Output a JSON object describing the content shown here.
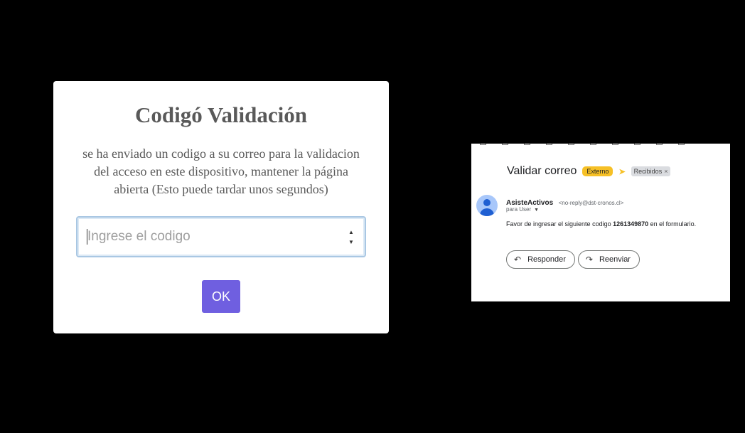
{
  "modal": {
    "title": "Codigó Validación",
    "message": "se ha enviado un codigo a su correo para la validacion del acceso en este dispositivo, mantener la página abierta (Esto puede tardar unos segundos)",
    "input_placeholder": "Ingrese el codigo",
    "ok_label": "OK",
    "ok_color": "#6f5fe0"
  },
  "email": {
    "subject": "Validar correo",
    "label_externo": "Externo",
    "label_recibidos": "Recibidos",
    "label_remove": "×",
    "sender_name": "AsisteActivos",
    "sender_email": "<no-reply@dst-cronos.cl>",
    "to_line": "para User",
    "body_prefix": "Favor de ingresar el siguiente codigo ",
    "code": "1261349870",
    "body_suffix": " en el formulario.",
    "reply_label": "Responder",
    "forward_label": "Reenviar",
    "icons": {
      "reply": "reply-icon",
      "forward": "forward-icon",
      "avatar": "avatar-icon",
      "label_arrow": "label-arrow-icon"
    }
  }
}
